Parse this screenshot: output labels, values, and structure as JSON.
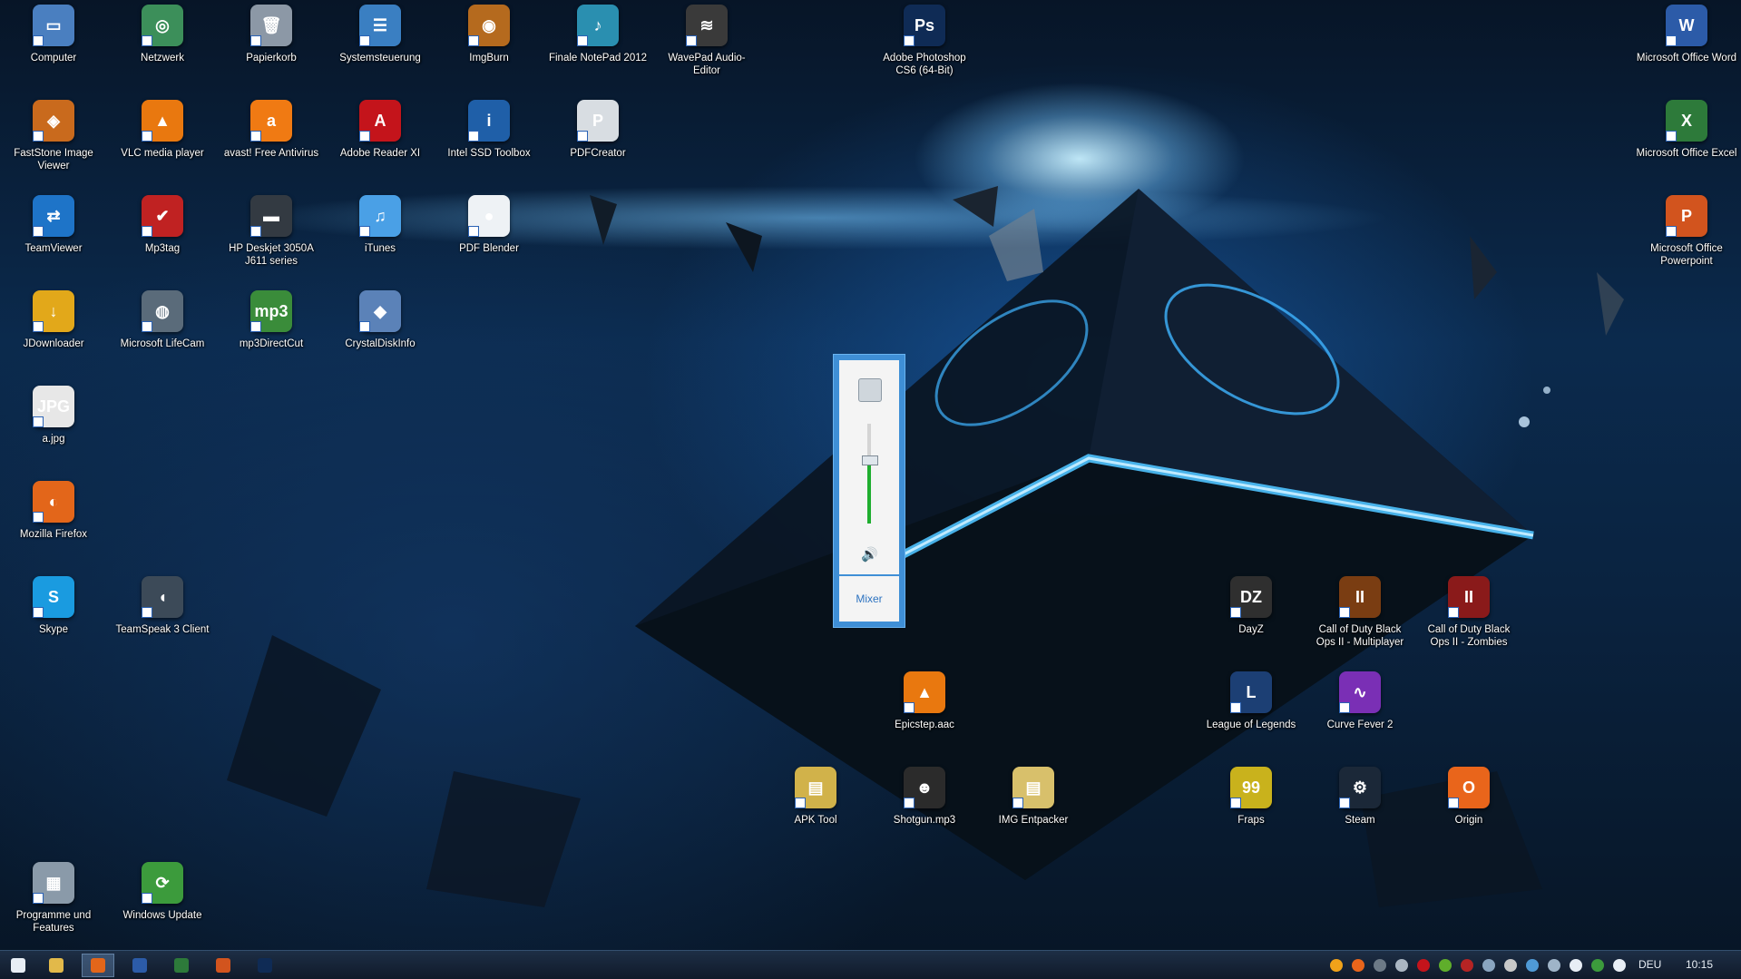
{
  "desktop_icons": [
    {
      "label": "Computer",
      "glyph": "▭",
      "color": "#4a7fc0"
    },
    {
      "label": "Netzwerk",
      "glyph": "◎",
      "color": "#3c8f5a"
    },
    {
      "label": "Papierkorb",
      "glyph": "🗑",
      "color": "#8c98a6"
    },
    {
      "label": "Systemsteuerung",
      "glyph": "☰",
      "color": "#3a7fc2"
    },
    {
      "label": "ImgBurn",
      "glyph": "◉",
      "color": "#b56a1e"
    },
    {
      "label": "Finale NotePad 2012",
      "glyph": "♪",
      "color": "#2a8fb0"
    },
    {
      "label": "WavePad Audio-Editor",
      "glyph": "≋",
      "color": "#3a3a3a"
    },
    {
      "label": "Adobe Photoshop CS6 (64-Bit)",
      "glyph": "Ps",
      "color": "#0f2b55"
    },
    {
      "label": "Microsoft Office Word",
      "glyph": "W",
      "color": "#2c5ba8"
    },
    {
      "label": "FastStone Image Viewer",
      "glyph": "◈",
      "color": "#c96a1d"
    },
    {
      "label": "VLC media player",
      "glyph": "▲",
      "color": "#e9780f"
    },
    {
      "label": "avast! Free Antivirus",
      "glyph": "a",
      "color": "#f07a13"
    },
    {
      "label": "Adobe Reader XI",
      "glyph": "A",
      "color": "#c4141b"
    },
    {
      "label": "Intel SSD Toolbox",
      "glyph": "i",
      "color": "#1f5fa8"
    },
    {
      "label": "PDFCreator",
      "glyph": "P",
      "color": "#d8dde2"
    },
    {
      "label": "Microsoft Office Excel",
      "glyph": "X",
      "color": "#2d7a3a"
    },
    {
      "label": "TeamViewer",
      "glyph": "⇄",
      "color": "#1e74c8"
    },
    {
      "label": "Mp3tag",
      "glyph": "✔",
      "color": "#c02222"
    },
    {
      "label": "HP Deskjet 3050A J611 series",
      "glyph": "▬",
      "color": "#333a42"
    },
    {
      "label": "iTunes",
      "glyph": "♫",
      "color": "#4aa0e6"
    },
    {
      "label": "PDF Blender",
      "glyph": "●",
      "color": "#eef2f5"
    },
    {
      "label": "Microsoft Office Powerpoint",
      "glyph": "P",
      "color": "#d2541e"
    },
    {
      "label": "JDownloader",
      "glyph": "↓",
      "color": "#e2a81a"
    },
    {
      "label": "Microsoft LifeCam",
      "glyph": "◍",
      "color": "#5a6b7a"
    },
    {
      "label": "mp3DirectCut",
      "glyph": "mp3",
      "color": "#3a8c3a"
    },
    {
      "label": "CrystalDiskInfo",
      "glyph": "◆",
      "color": "#5b82b8"
    },
    {
      "label": "a.jpg",
      "glyph": "JPG",
      "color": "#e7e7e7"
    },
    {
      "label": "Mozilla Firefox",
      "glyph": "◐",
      "color": "#e3661a"
    },
    {
      "label": "Skype",
      "glyph": "S",
      "color": "#1a9be0"
    },
    {
      "label": "TeamSpeak 3 Client",
      "glyph": "◖",
      "color": "#3c4a58"
    },
    {
      "label": "DayZ",
      "glyph": "DZ",
      "color": "#2f2f2f"
    },
    {
      "label": "Call of Duty Black Ops II - Multiplayer",
      "glyph": "II",
      "color": "#7a3d12"
    },
    {
      "label": "Call of Duty Black Ops II - Zombies",
      "glyph": "II",
      "color": "#8a1a1a"
    },
    {
      "label": "Epicstep.aac",
      "glyph": "▲",
      "color": "#e9780f"
    },
    {
      "label": "League of Legends",
      "glyph": "L",
      "color": "#1c3f74"
    },
    {
      "label": "Curve Fever 2",
      "glyph": "∿",
      "color": "#7a2fb5"
    },
    {
      "label": "APK Tool",
      "glyph": "▤",
      "color": "#d1b24a"
    },
    {
      "label": "Shotgun.mp3",
      "glyph": "☻",
      "color": "#2b2b2b"
    },
    {
      "label": "IMG Entpacker",
      "glyph": "▤",
      "color": "#d8c06b"
    },
    {
      "label": "Fraps",
      "glyph": "99",
      "color": "#c9b21c"
    },
    {
      "label": "Steam",
      "glyph": "⚙",
      "color": "#1b2838"
    },
    {
      "label": "Origin",
      "glyph": "O",
      "color": "#e9651b"
    },
    {
      "label": "Programme und Features",
      "glyph": "▦",
      "color": "#8a9aa9"
    },
    {
      "label": "Windows Update",
      "glyph": "⟳",
      "color": "#3c9b3c"
    }
  ],
  "volume_flyout": {
    "level_percent": 65,
    "speaker_icon": "speaker-icon",
    "mixer_label": "Mixer"
  },
  "taskbar": {
    "pinned": [
      {
        "name": "start-icon",
        "color": "#e8eef5"
      },
      {
        "name": "explorer-icon",
        "color": "#e2b94a"
      },
      {
        "name": "firefox-icon",
        "color": "#e3661a",
        "active": true
      },
      {
        "name": "word-icon",
        "color": "#2c5ba8"
      },
      {
        "name": "excel-icon",
        "color": "#2d7a3a"
      },
      {
        "name": "powerpoint-icon",
        "color": "#d2541e"
      },
      {
        "name": "photoshop-icon",
        "color": "#0f2b55"
      }
    ],
    "tray": [
      {
        "name": "avast-tray-icon",
        "color": "#f0a21a"
      },
      {
        "name": "origin-tray-icon",
        "color": "#e9651b"
      },
      {
        "name": "g-tray-icon",
        "color": "#6d7a87"
      },
      {
        "name": "steam-tray-icon",
        "color": "#aab6c3"
      },
      {
        "name": "adobe-tray-icon",
        "color": "#c4141b"
      },
      {
        "name": "nvidia-tray-icon",
        "color": "#5fae2b"
      },
      {
        "name": "roccat-tray-icon",
        "color": "#b52424"
      },
      {
        "name": "network-activity-icon",
        "color": "#8aa5c0"
      },
      {
        "name": "tool-tray-icon",
        "color": "#c8c8c8"
      },
      {
        "name": "teamspeak-tray-icon",
        "color": "#4f9ad6"
      },
      {
        "name": "safely-remove-icon",
        "color": "#9fb4c8"
      },
      {
        "name": "volume-tray-icon",
        "color": "#e8eef5"
      },
      {
        "name": "update-tray-icon",
        "color": "#3c9b3c"
      },
      {
        "name": "network-tray-icon",
        "color": "#e8eef5"
      }
    ],
    "language": "DEU",
    "time": "10:15"
  }
}
